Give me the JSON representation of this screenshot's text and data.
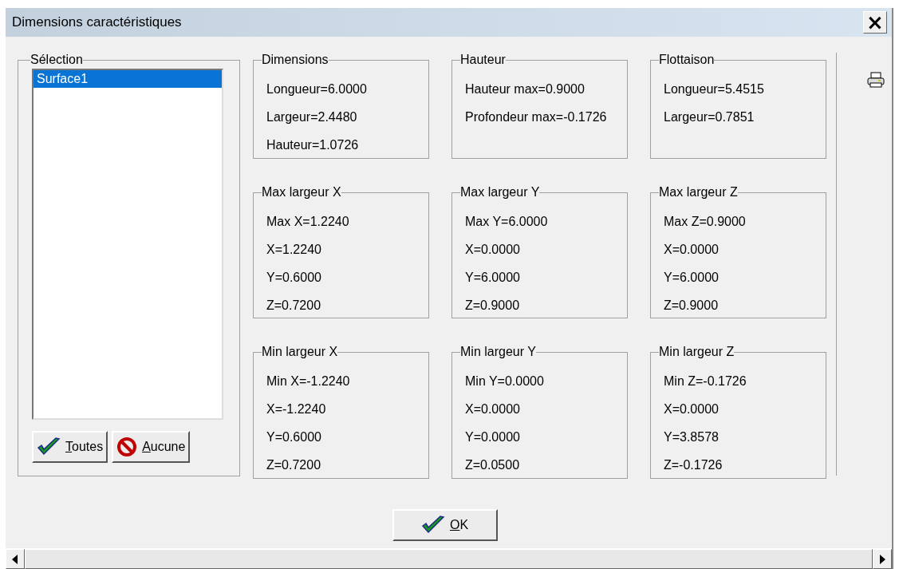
{
  "window": {
    "title": "Dimensions caractéristiques",
    "close": "×"
  },
  "selection": {
    "title": "Sélection",
    "items": [
      {
        "label": "Surface1",
        "selected": true
      }
    ],
    "buttons": [
      {
        "label": "Toutes",
        "kind": "check"
      },
      {
        "label": "Aucune",
        "kind": "forbid"
      }
    ]
  },
  "groups": [
    {
      "title": "Dimensions",
      "lines": [
        "Longueur=6.0000",
        "Largeur=2.4480",
        "Hauteur=1.0726"
      ]
    },
    {
      "title": "Hauteur",
      "lines": [
        "Hauteur max=0.9000",
        "Profondeur max=-0.1726"
      ]
    },
    {
      "title": "Flottaison",
      "lines": [
        "Longueur=5.4515",
        "Largeur=0.7851"
      ]
    },
    {
      "title": "Max largeur X",
      "lines": [
        "Max X=1.2240",
        "X=1.2240",
        "Y=0.6000",
        "Z=0.7200"
      ]
    },
    {
      "title": "Max largeur Y",
      "lines": [
        "Max Y=6.0000",
        "X=0.0000",
        "Y=6.0000",
        "Z=0.9000"
      ]
    },
    {
      "title": "Max largeur Z",
      "lines": [
        "Max Z=0.9000",
        "X=0.0000",
        "Y=6.0000",
        "Z=0.9000"
      ]
    },
    {
      "title": "Min largeur X",
      "lines": [
        "Min X=-1.2240",
        "X=-1.2240",
        "Y=0.6000",
        "Z=0.7200"
      ]
    },
    {
      "title": "Min largeur Y",
      "lines": [
        "Min Y=0.0000",
        "X=0.0000",
        "Y=0.0000",
        "Z=0.0500"
      ]
    },
    {
      "title": "Min largeur Z",
      "lines": [
        "Min Z=-0.1726",
        "X=0.0000",
        "Y=3.8578",
        "Z=-0.1726"
      ]
    }
  ],
  "ok_button": {
    "label": "OK",
    "kind": "check"
  }
}
